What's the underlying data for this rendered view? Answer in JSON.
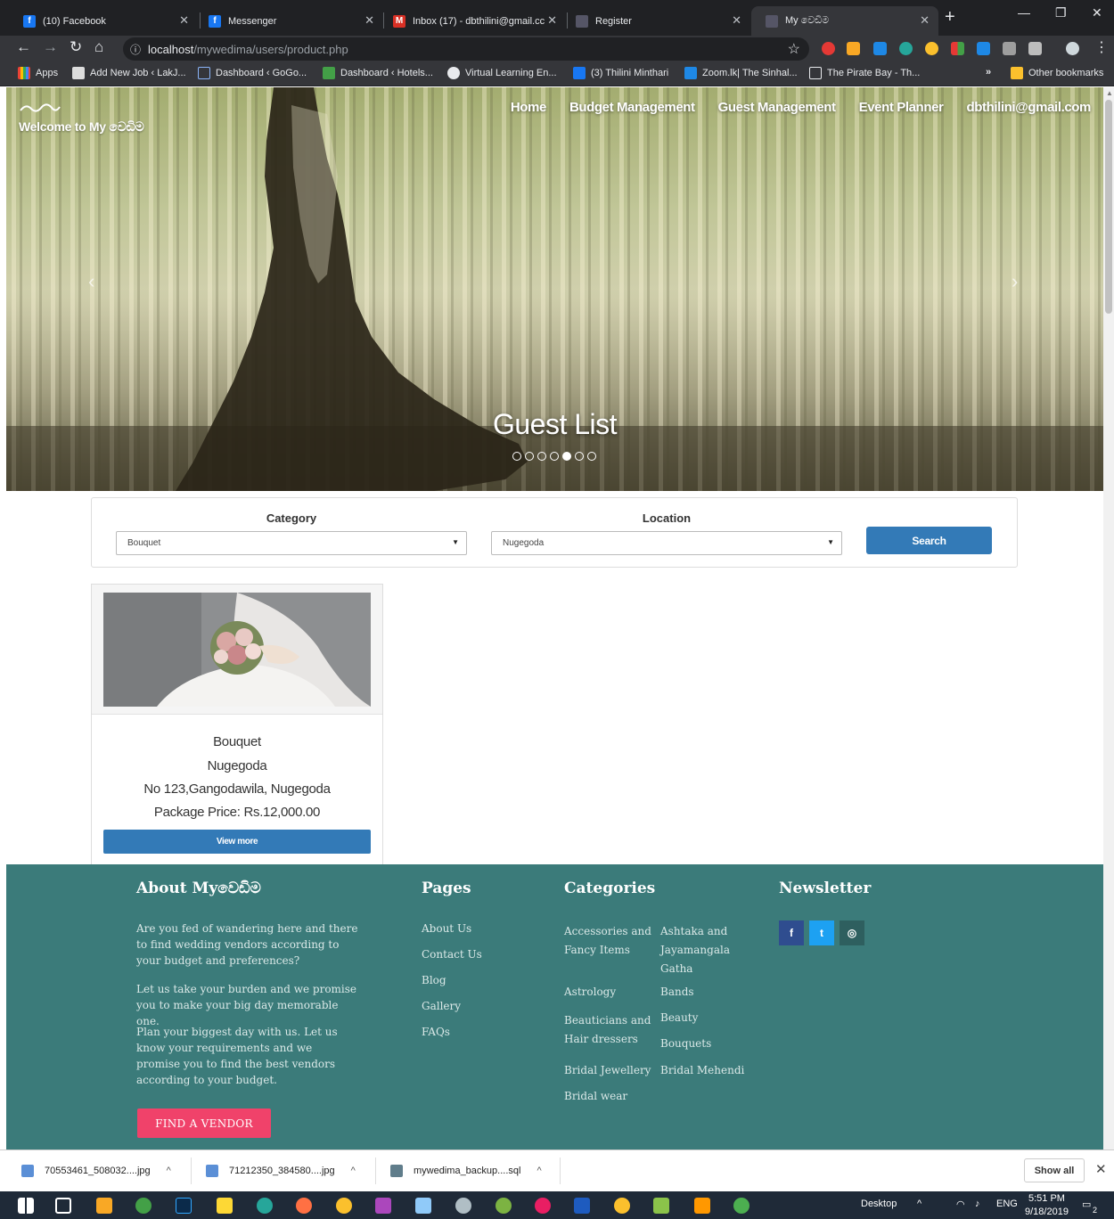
{
  "browser": {
    "tabs": [
      {
        "label": "(10) Facebook",
        "active": false
      },
      {
        "label": "Messenger",
        "active": false
      },
      {
        "label": "Inbox (17) - dbthilini@gmail.cc",
        "active": false
      },
      {
        "label": "Register",
        "active": false
      },
      {
        "label": "My වෙඩිම",
        "active": true
      }
    ],
    "url_host": "localhost",
    "url_path": "/mywedima/users/product.php",
    "bookmarks": [
      "Apps",
      "Add New Job ‹ LakJ...",
      "Dashboard ‹ GoGo...",
      "Dashboard ‹ Hotels...",
      "Virtual Learning En...",
      "(3) Thilini Minthari",
      "Zoom.lk| The Sinhal...",
      "The Pirate Bay - Th...",
      "Other bookmarks"
    ],
    "bookmarks_more": "»"
  },
  "header": {
    "brand": "Welcome to My වෙඩිම",
    "nav": [
      "Home",
      "Budget Management",
      "Guest Management",
      "Event Planner",
      "dbthilini@gmail.com"
    ]
  },
  "hero": {
    "caption": "Guest List",
    "slide_count": 7,
    "active_slide": 4
  },
  "search": {
    "category_label": "Category",
    "category_value": "Bouquet",
    "location_label": "Location",
    "location_value": "Nugegoda",
    "button": "Search"
  },
  "product": {
    "name": "Bouquet",
    "location": "Nugegoda",
    "address": "No 123,Gangodawila, Nugegoda",
    "price": "Package Price: Rs.12,000.00",
    "button": "View more"
  },
  "footer": {
    "about_title": "About Myවෙඩිම",
    "about_p1": "Are you fed of wandering here and there to find wedding vendors according to your budget and preferences?",
    "about_p2": "Let us take your burden and we promise you to make your big day memorable one.",
    "about_p3": "Plan your biggest day with us. Let us know your requirements and we promise you to find the best vendors according to your budget.",
    "find_button": "FIND A VENDOR",
    "pages_title": "Pages",
    "pages": [
      "About Us",
      "Contact Us",
      "Blog",
      "Gallery",
      "FAQs"
    ],
    "categories_title": "Categories",
    "categories_left": [
      "Accessories and Fancy Items",
      "Astrology",
      "Beauticians and Hair dressers",
      "Bridal Jewellery",
      "Bridal wear"
    ],
    "categories_right": [
      "Ashtaka and Jayamangala Gatha",
      "Bands",
      "Beauty",
      "Bouquets",
      "Bridal Mehendi"
    ],
    "newsletter_title": "Newsletter",
    "social": [
      "f",
      "t",
      "◎"
    ]
  },
  "downloads": {
    "items": [
      "70553461_508032....jpg",
      "71212350_384580....jpg",
      "mywedima_backup....sql"
    ],
    "show_all": "Show all"
  },
  "taskbar": {
    "desktop_label": "Desktop",
    "lang": "ENG",
    "time": "5:51 PM",
    "date": "9/18/2019",
    "notif_count": "2"
  },
  "colors": {
    "primary_button": "#337ab7",
    "footer_bg": "#3b7b7a",
    "find_button": "#f0426a"
  }
}
